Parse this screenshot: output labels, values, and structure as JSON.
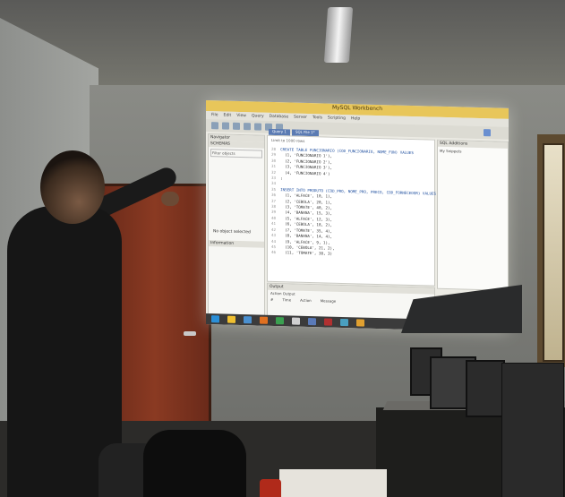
{
  "app": {
    "window_title": "MySQL Workbench",
    "menu": [
      "File",
      "Edit",
      "View",
      "Query",
      "Database",
      "Server",
      "Tools",
      "Scripting",
      "Help"
    ],
    "tabs": [
      "Query 1",
      "SQL File 1*"
    ],
    "navigator": {
      "title": "Navigator",
      "schemas_label": "SCHEMAS",
      "filter_placeholder": "Filter objects",
      "info_label": "Information",
      "empty_message": "No object selected"
    },
    "limit_label": "Limit to 1000 rows",
    "right_panel_title": "SQL Additions",
    "snippets_label": "My Snippets",
    "output_label": "Output",
    "action_output_label": "Action Output",
    "output_columns": [
      "#",
      "Time",
      "Action",
      "Message"
    ]
  },
  "code_lines": [
    {
      "no": "28",
      "text": "CREATE TABLE FUNCIONARIO (COD_FUNCIONARIO, NOME_FUN) VALUES"
    },
    {
      "no": "29",
      "text": "  (1, 'FUNCIONARIO 1'),"
    },
    {
      "no": "30",
      "text": "  (2, 'FUNCIONARIO 2'),"
    },
    {
      "no": "31",
      "text": "  (3, 'FUNCIONARIO 3'),"
    },
    {
      "no": "32",
      "text": "  (4, 'FUNCIONARIO 4')"
    },
    {
      "no": "33",
      "text": ";"
    },
    {
      "no": "34",
      "text": ""
    },
    {
      "no": "35",
      "text": "INSERT INTO PRODUTO (COD_PRO, NOME_PRO, PRECO, COD_FORNECEDOR) VALUES"
    },
    {
      "no": "36",
      "text": "  (1, 'ALFACE', 10, 1),"
    },
    {
      "no": "37",
      "text": "  (2, 'CEBOLA', 20, 1),"
    },
    {
      "no": "38",
      "text": "  (3, 'TOMATE', 40, 2),"
    },
    {
      "no": "39",
      "text": "  (4, 'BANANA', 15, 3),"
    },
    {
      "no": "40",
      "text": "  (5, 'ALFACE', 12, 3),"
    },
    {
      "no": "41",
      "text": "  (6, 'CEBOLA', 18, 2),"
    },
    {
      "no": "42",
      "text": "  (7, 'TOMATE', 35, 4),"
    },
    {
      "no": "43",
      "text": "  (8, 'BANANA', 14, 4),"
    },
    {
      "no": "44",
      "text": "  (9, 'ALFACE', 9, 1),"
    },
    {
      "no": "45",
      "text": "  (10, 'CEBOLA', 21, 2),"
    },
    {
      "no": "46",
      "text": "  (11, 'TOMATE', 38, 3)"
    }
  ]
}
